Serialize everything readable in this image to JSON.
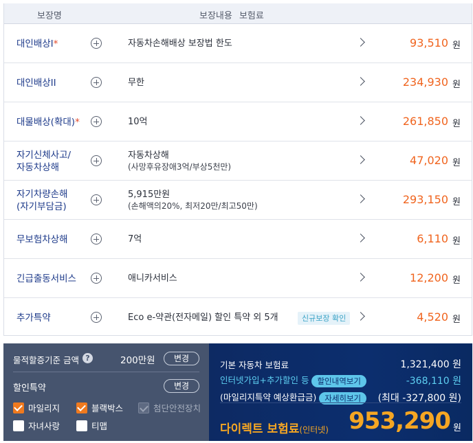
{
  "table": {
    "header_name": "보장명",
    "header_content": "보장내용 보험료",
    "currency": "원",
    "rows": [
      {
        "name": "대인배상I",
        "star": "*",
        "desc": "자동차손해배상 보장법 한도",
        "sub": "",
        "badge": "",
        "amount": "93,510"
      },
      {
        "name": "대인배상II",
        "star": "",
        "desc": "무한",
        "sub": "",
        "badge": "",
        "amount": "234,930"
      },
      {
        "name": "대물배상(확대)",
        "star": "*",
        "desc": "10억",
        "sub": "",
        "badge": "",
        "amount": "261,850"
      },
      {
        "name": "자기신체사고/",
        "name2": "자동차상해",
        "star": "",
        "desc": "자동차상해",
        "sub": "(사망후유장애3억/부상5천만)",
        "badge": "",
        "amount": "47,020"
      },
      {
        "name": "자기차량손해",
        "name2": "(자기부담금)",
        "star": "",
        "desc": "5,915만원",
        "sub": "(손해액의20%, 최저20만/최고50만)",
        "badge": "",
        "amount": "293,150"
      },
      {
        "name": "무보험차상해",
        "star": "",
        "desc": "7억",
        "sub": "",
        "badge": "",
        "amount": "6,110"
      },
      {
        "name": "긴급출동서비스",
        "star": "",
        "desc": "애니카서비스",
        "sub": "",
        "badge": "",
        "amount": "12,200"
      },
      {
        "name": "추가특약",
        "star": "",
        "desc": "Eco e-약관(전자메일) 할인 특약 외 5개",
        "sub": "",
        "badge": "신규보장 확인",
        "amount": "4,520"
      }
    ]
  },
  "options": {
    "limit_label": "물적할증기준 금액",
    "limit_value": "200만원",
    "change_label": "변경",
    "discount_title": "할인특약",
    "checkboxes": [
      {
        "label": "마일리지",
        "state": "checked"
      },
      {
        "label": "블랙박스",
        "state": "checked"
      },
      {
        "label": "첨단안전장치",
        "state": "disabled"
      },
      {
        "label": "자녀사랑",
        "state": "unchecked"
      },
      {
        "label": "티맵",
        "state": "unchecked"
      }
    ]
  },
  "summary": {
    "base_label": "기본 자동차 보험료",
    "base_value": "1,321,400 원",
    "discount_label": "인터넷가입+추가할인 등",
    "discount_button": "할인내역보기",
    "discount_value": "-368,110 원",
    "mileage_label": "(마일리지특약 예상환급금)",
    "mileage_button": "자세히보기",
    "mileage_value": "(최대 -327,800 원)",
    "direct_label": "다이렉트 보험료",
    "direct_label_small": "(인터넷)",
    "direct_value": "953,290",
    "direct_won": "원"
  },
  "colors": {
    "amount_orange": "#f0641e",
    "name_blue": "#1d3a8a",
    "panel_gray": "#46546e",
    "panel_navy": "#0c2e6e",
    "highlight_orange": "#f5a623",
    "cyan": "#5ed0f2"
  }
}
